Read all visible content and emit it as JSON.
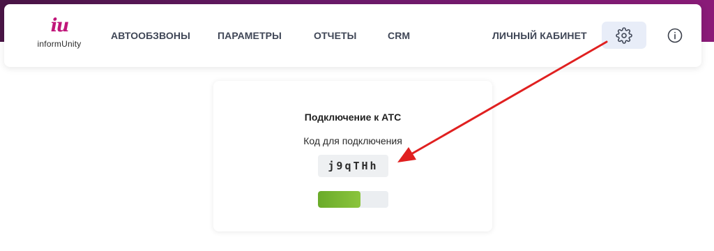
{
  "header": {
    "logo": {
      "mark": "iu",
      "text": "informUnity"
    },
    "nav": [
      {
        "label": "АВТООБЗВОНЫ"
      },
      {
        "label": "ПАРАМЕТРЫ"
      },
      {
        "label": "ОТЧЕТЫ"
      },
      {
        "label": "CRM"
      }
    ],
    "cabinet_label": "ЛИЧНЫЙ КАБИНЕТ",
    "settings_icon": "gear-icon",
    "info_icon": "info-icon"
  },
  "card": {
    "title": "Подключение к АТС",
    "subtitle": "Код для подключения",
    "code": "j9qTHh",
    "progress_fraction": 0.6
  },
  "colors": {
    "brand": "#c0167a",
    "progress": "#7ab535",
    "arrow": "#e02020",
    "settings_bg": "#e8edf8"
  }
}
